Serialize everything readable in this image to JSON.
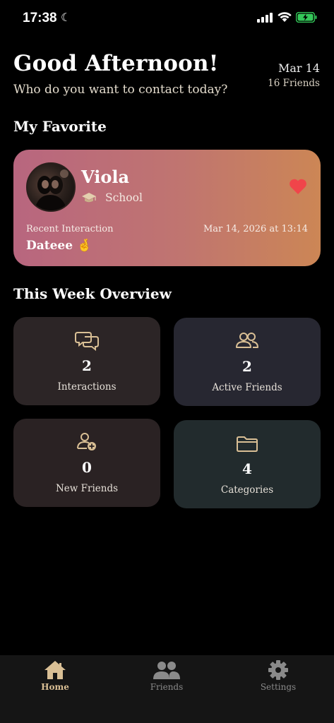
{
  "status_bar": {
    "time": "17:38"
  },
  "header": {
    "greeting": "Good Afternoon!",
    "subtitle": "Who do you want to contact today?",
    "date": "Mar 14",
    "friends_count": "16 Friends"
  },
  "favorite": {
    "section_title": "My Favorite",
    "name": "Viola",
    "category": "School",
    "recent_label": "Recent Interaction",
    "recent_date": "Mar 14, 2026 at 13:14",
    "recent_text": "Dateee 🤞"
  },
  "overview": {
    "section_title": "This Week Overview",
    "tiles": [
      {
        "value": "2",
        "label": "Interactions",
        "icon": "chat-bubbles-icon"
      },
      {
        "value": "2",
        "label": "Active Friends",
        "icon": "people-icon"
      },
      {
        "value": "0",
        "label": "New Friends",
        "icon": "add-person-icon"
      },
      {
        "value": "4",
        "label": "Categories",
        "icon": "folder-icon"
      }
    ]
  },
  "tabs": [
    {
      "label": "Home",
      "icon": "home-icon",
      "active": true
    },
    {
      "label": "Friends",
      "icon": "friends-icon",
      "active": false
    },
    {
      "label": "Settings",
      "icon": "gear-icon",
      "active": false
    }
  ],
  "colors": {
    "accent": "#d9bf95",
    "heart": "#f0454a",
    "tile_1": "#2c2526",
    "tile_2": "#272731",
    "tile_3": "#2a2223",
    "tile_4": "#222b2d"
  }
}
